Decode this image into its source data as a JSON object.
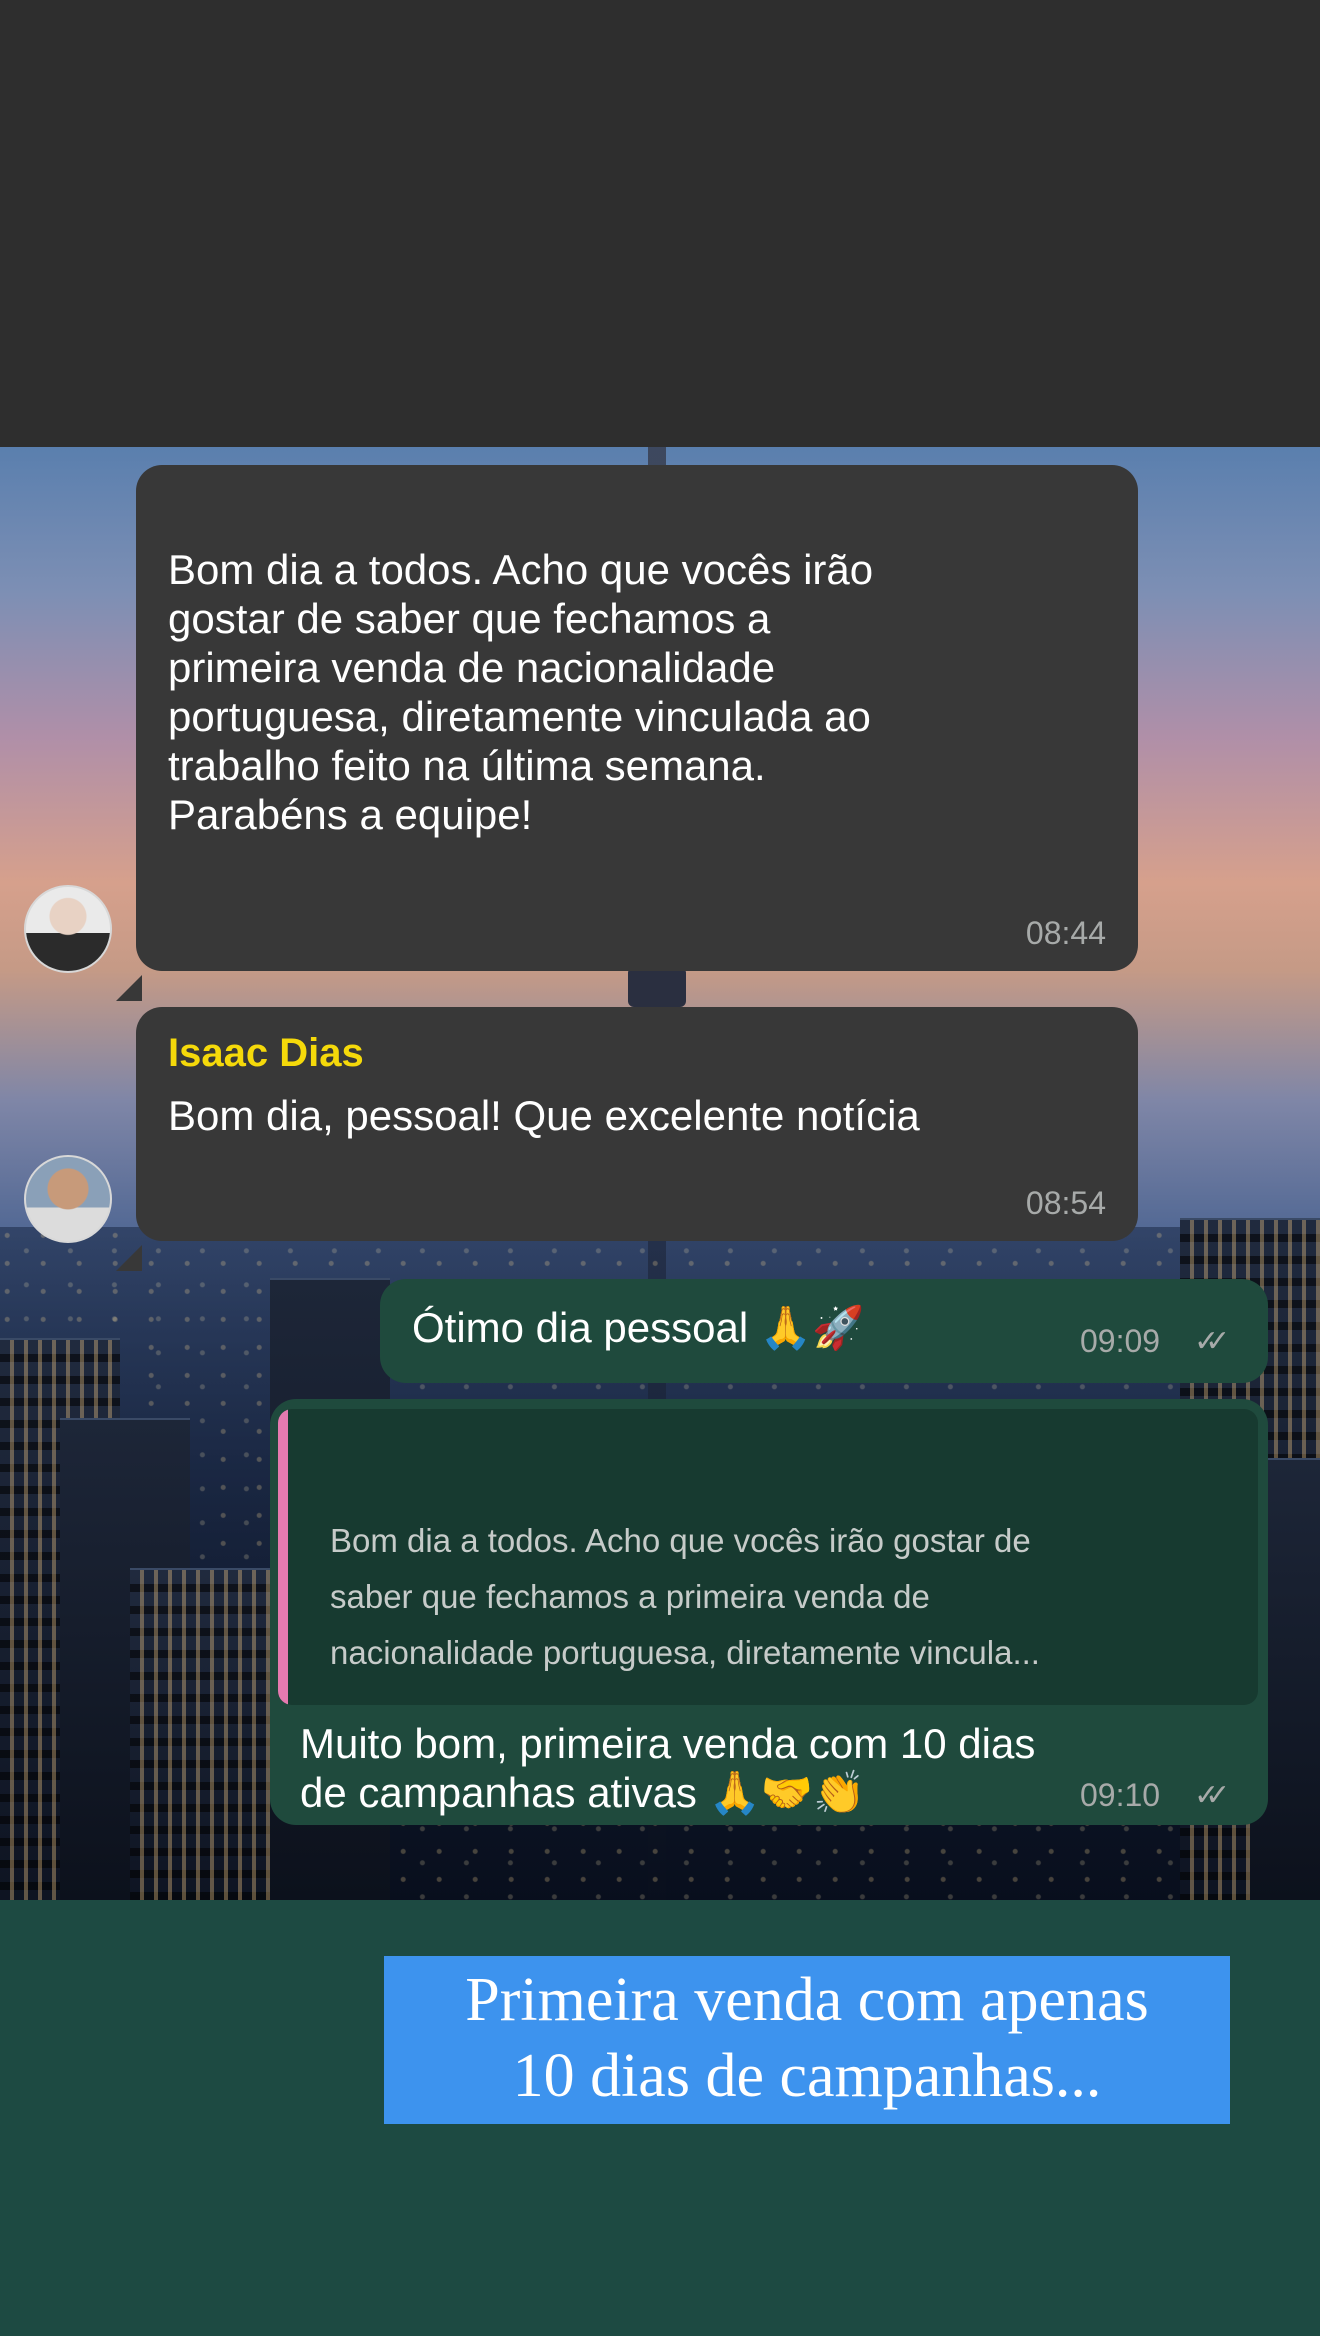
{
  "messages": [
    {
      "type": "incoming",
      "text": "Bom dia a todos. Acho que vocês irão\ngostar de saber que fechamos a\nprimeira venda de nacionalidade\nportuguesa, diretamente vinculada ao\ntrabalho feito na última semana.\nParabéns a equipe!",
      "time": "08:44"
    },
    {
      "type": "incoming",
      "sender": "Isaac Dias",
      "text": "Bom dia, pessoal! Que excelente notícia",
      "time": "08:54"
    },
    {
      "type": "outgoing",
      "text": "Ótimo dia pessoal 🙏🚀",
      "time": "09:09",
      "read_checks": "✓✓"
    },
    {
      "type": "outgoing",
      "quoted_text": "Bom dia a todos. Acho que vocês irão gostar de\nsaber que fechamos a primeira venda de\nnacionalidade portuguesa, diretamente vincula...",
      "text": "Muito bom, primeira venda com 10 dias\nde campanhas ativas 🙏🤝👏",
      "time": "09:10",
      "read_checks": "✓✓"
    }
  ],
  "caption": "Primeira venda com apenas\n10 dias de campanhas...",
  "colors": {
    "incoming_bubble": "#383838",
    "outgoing_bubble": "#1f4a3d",
    "sender_name": "#f5d90a",
    "quote_bar": "#e57ab0",
    "caption_bg": "#3d93ee",
    "bottom_band": "#1d4a42"
  }
}
